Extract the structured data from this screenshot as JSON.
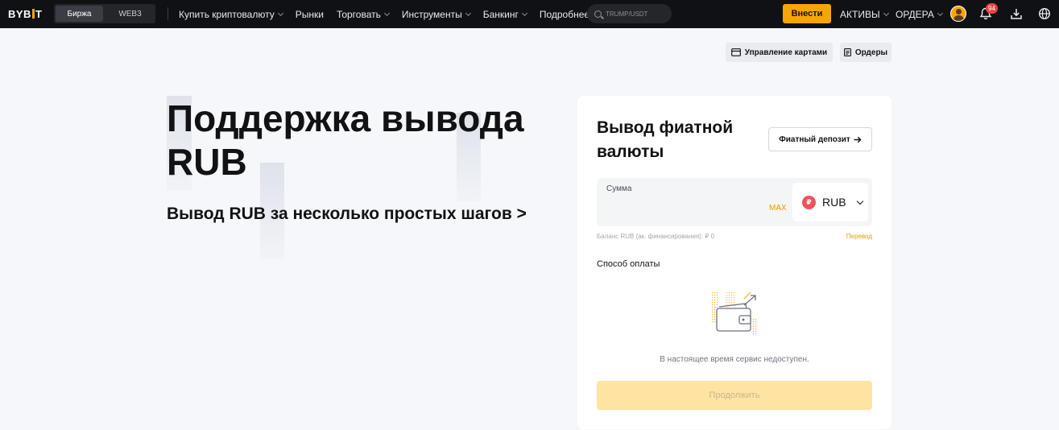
{
  "brand": {
    "logo_left": "BYB",
    "logo_right": "T"
  },
  "switch": {
    "exchange": "Биржа",
    "web3": "WEB3"
  },
  "nav": [
    {
      "label": "Купить криптовалюту",
      "dropdown": true
    },
    {
      "label": "Рынки",
      "dropdown": false
    },
    {
      "label": "Торговать",
      "dropdown": true
    },
    {
      "label": "Инструменты",
      "dropdown": true
    },
    {
      "label": "Банкинг",
      "dropdown": true
    },
    {
      "label": "Подробнее",
      "dropdown": true
    }
  ],
  "search": {
    "placeholder": "TRUMP/USDT"
  },
  "header": {
    "deposit_label": "Внести",
    "assets_label": "АКТИВЫ",
    "orders_label": "ОРДЕРА",
    "notification_count": "94"
  },
  "toolbar": {
    "manage_cards_label": "Управление картами",
    "orders_label": "Ордеры"
  },
  "hero": {
    "title": "Поддержка вывода RUB",
    "subtitle": "Вывод RUB за несколько простых шагов >"
  },
  "card": {
    "title": "Вывод фиатной валюты",
    "fiat_deposit_label": "Фиатный депозит",
    "amount_label": "Сумма",
    "max_label": "MAX",
    "currency": "RUB",
    "currency_symbol": "₽",
    "balance_text": "Баланс RUB (ак. финансирования):  ₽ 0",
    "transfer_label": "Перевод",
    "payment_method_label": "Способ оплаты",
    "unavailable_text": "В настоящее время сервис недоступен.",
    "continue_label": "Продолжить"
  },
  "colors": {
    "accent": "#f7a600",
    "topbar_bg": "#101114",
    "page_bg": "#f5f7fa",
    "continue_disabled": "#ffe3a3",
    "badge": "#e84444"
  }
}
